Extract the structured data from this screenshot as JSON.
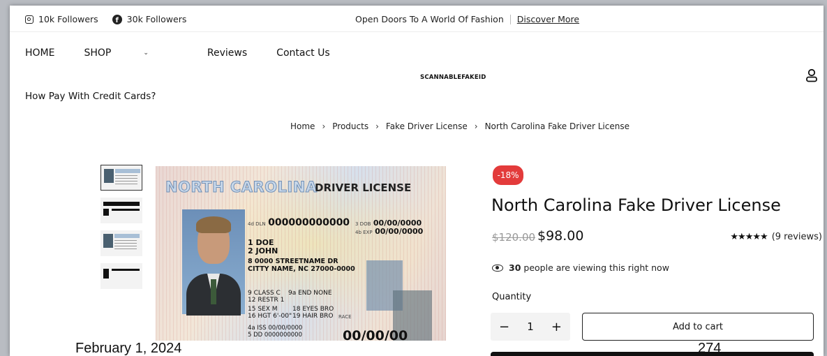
{
  "topbar": {
    "instagram": "10k Followers",
    "facebook": "30k Followers",
    "promo_text": "Open Doors To A World Of Fashion",
    "promo_link": "Discover More"
  },
  "nav": {
    "items": [
      "HOME",
      "SHOP",
      "Reviews",
      "Contact Us"
    ],
    "secondary": "How Pay With Credit Cards?"
  },
  "logo": "SCANNABLEFAKEID",
  "breadcrumb": [
    "Home",
    "Products",
    "Fake Driver License",
    "North Carolina Fake Driver License"
  ],
  "card": {
    "state": "NORTH CAROLINA",
    "type": "DRIVER LICENSE",
    "dln_label": "4d DLN",
    "dln": "000000000000",
    "dob_label": "3 DOB",
    "dob": "00/00/0000",
    "exp_label": "4b EXP",
    "exp": "00/00/0000",
    "last": "1 DOE",
    "first": "2 JOHN",
    "street": "8 0000 STREETNAME DR",
    "city": "CITTY NAME, NC 27000-0000",
    "class": "9 CLASS C",
    "end": "9a END NONE",
    "restr": "12 RESTR 1",
    "sex": "15 SEX M",
    "eyes": "18 EYES BRO",
    "hgt": "16 HGT 6'-00\"",
    "hair": "19 HAIR BRO",
    "race": "RACE",
    "iss": "4a ISS 00/00/0000",
    "dd": "5 DD 0000000000",
    "expiry_big": "00/00/00"
  },
  "product": {
    "discount": "-18%",
    "title": "North Carolina Fake Driver License",
    "price_old": "$120.00",
    "price_new": "$98.00",
    "stars": "★★★★★",
    "reviews": "(9 reviews)",
    "viewers_count": "30",
    "viewers_text": "people are viewing this right now",
    "quantity_label": "Quantity",
    "quantity": "1",
    "minus": "−",
    "plus": "+",
    "add_to_cart": "Add to cart"
  },
  "caption": {
    "date": "February 1, 2024",
    "number": "274"
  }
}
